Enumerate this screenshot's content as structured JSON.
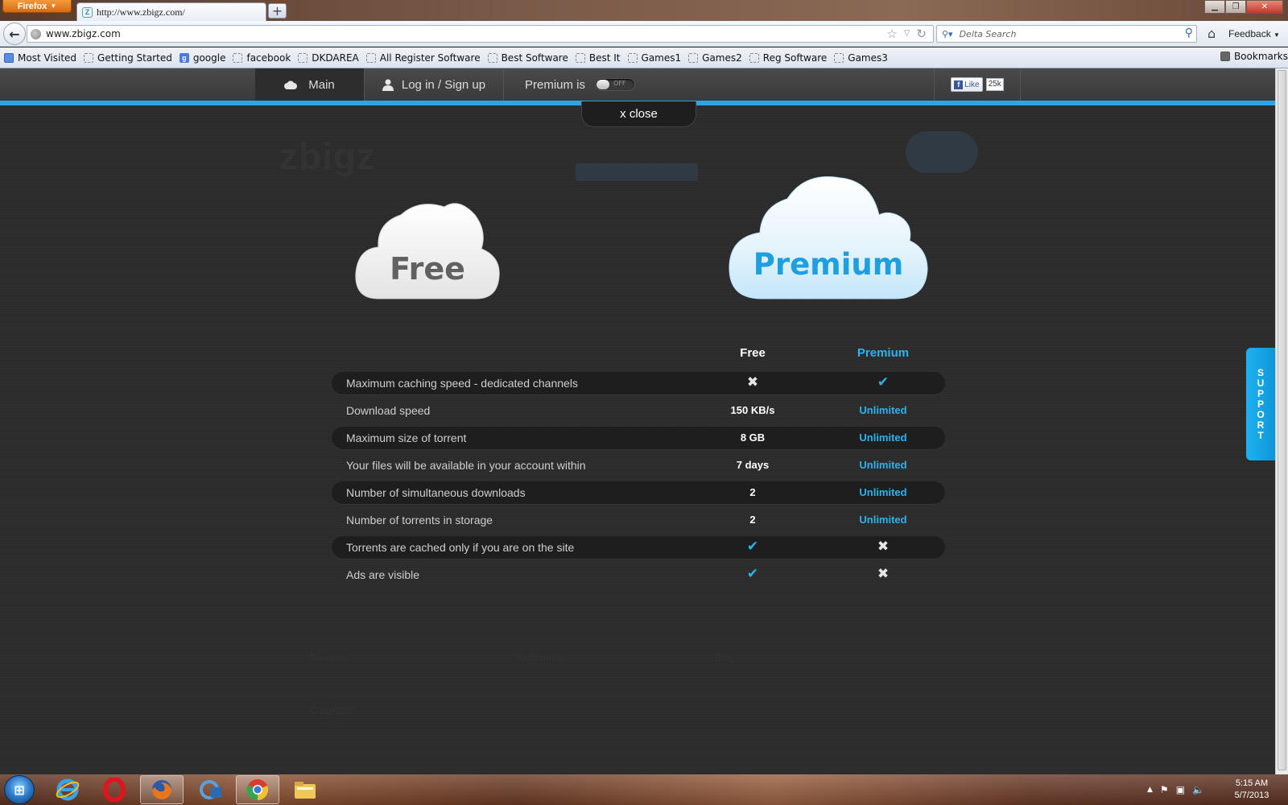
{
  "browser": {
    "menu_button": "Firefox",
    "tab_title": "http://www.zbigz.com/",
    "url": "www.zbigz.com",
    "search_placeholder": "Delta Search",
    "feedback": "Feedback",
    "bookmarks": [
      {
        "label": "Most Visited",
        "icon": "most-visited-icon"
      },
      {
        "label": "Getting Started",
        "icon": "page-icon"
      },
      {
        "label": "google",
        "icon": "google-icon"
      },
      {
        "label": "facebook",
        "icon": "page-icon"
      },
      {
        "label": "DKDAREA",
        "icon": "page-icon"
      },
      {
        "label": "All Register Software",
        "icon": "page-icon"
      },
      {
        "label": "Best Software",
        "icon": "page-icon"
      },
      {
        "label": "Best It",
        "icon": "page-icon"
      },
      {
        "label": "Games1",
        "icon": "page-icon"
      },
      {
        "label": "Games2",
        "icon": "page-icon"
      },
      {
        "label": "Reg Software",
        "icon": "page-icon"
      },
      {
        "label": "Games3",
        "icon": "page-icon"
      }
    ],
    "bookmarks_menu": "Bookmarks"
  },
  "site_nav": {
    "main": "Main",
    "login": "Log in / Sign up",
    "premium_is": "Premium is",
    "toggle_state": "OFF",
    "fb_like": "Like",
    "fb_count": "25k"
  },
  "close_label": "x close",
  "ghost": {
    "logo": "zbigz",
    "footer_1": "Services",
    "footer_2": "Technology",
    "footer_3": "Blog",
    "footer_4": "Copyright"
  },
  "plans": {
    "free_cloud": "Free",
    "premium_cloud": "Premium"
  },
  "compare": {
    "head_free": "Free",
    "head_premium": "Premium",
    "rows": [
      {
        "label": "Maximum caching speed - dedicated channels",
        "free": "cross",
        "premium": "check"
      },
      {
        "label": "Download speed",
        "free": "150 KB/s",
        "premium": "Unlimited"
      },
      {
        "label": "Maximum size of torrent",
        "free": "8 GB",
        "premium": "Unlimited"
      },
      {
        "label": "Your files will be available in your account within",
        "free": "7 days",
        "premium": "Unlimited"
      },
      {
        "label": "Number of simultaneous downloads",
        "free": "2",
        "premium": "Unlimited"
      },
      {
        "label": "Number of torrents in storage",
        "free": "2",
        "premium": "Unlimited"
      },
      {
        "label": "Torrents are cached only if you are on the site",
        "free": "check",
        "premium": "cross"
      },
      {
        "label": "Ads are visible",
        "free": "check",
        "premium": "cross"
      }
    ]
  },
  "support_label": "SUPPORT",
  "colors": {
    "accent_blue": "#2ab4ef",
    "nav_bar_blue": "#2aa6e6",
    "page_bg": "#2c2c2c"
  },
  "taskbar": {
    "apps": [
      "internet-explorer-icon",
      "opera-icon",
      "firefox-icon",
      "outlook-icon",
      "chrome-icon",
      "explorer-folder-icon"
    ],
    "time": "5:15 AM",
    "date": "5/7/2013"
  }
}
